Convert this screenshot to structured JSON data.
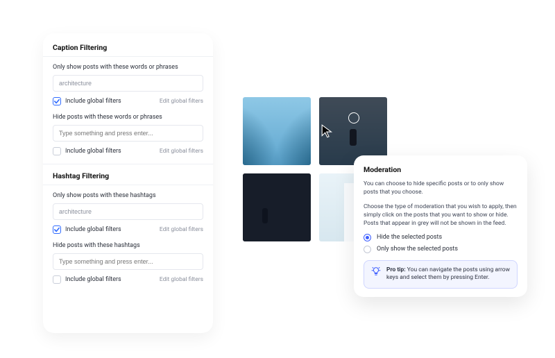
{
  "settings": {
    "caption": {
      "heading": "Caption Filtering",
      "show": {
        "label": "Only show posts with these words or phrases",
        "value": "architecture",
        "include_checked": true,
        "include_label": "Include global filters",
        "edit": "Edit global filters"
      },
      "hide": {
        "label": "Hide posts with these words or phrases",
        "placeholder": "Type something and press enter...",
        "include_checked": false,
        "include_label": "Include global filters",
        "edit": "Edit global filters"
      }
    },
    "hashtag": {
      "heading": "Hashtag Filtering",
      "show": {
        "label": "Only show posts with these hashtags",
        "value": "architecture",
        "include_checked": true,
        "include_label": "Include global filters",
        "edit": "Edit global filters"
      },
      "hide": {
        "label": "Hide posts with these hashtags",
        "placeholder": "Type something and press enter...",
        "include_checked": false,
        "include_label": "Include global filters",
        "edit": "Edit global filters"
      }
    }
  },
  "grid": {
    "items": [
      {
        "name": "post-1",
        "muted": false
      },
      {
        "name": "post-2",
        "muted": true
      },
      {
        "name": "post-3",
        "muted": true
      },
      {
        "name": "post-4",
        "muted": false
      }
    ]
  },
  "moderation": {
    "heading": "Moderation",
    "p1": "You can choose to hide specific posts or to only show posts that you choose.",
    "p2": "Choose the type of moderation that you wish to apply, then simply click on the posts that you want to show or hide. Posts that appear in grey will not be shown in the feed.",
    "options": [
      {
        "label": "Hide the selected posts",
        "selected": true
      },
      {
        "label": "Only show the selected posts",
        "selected": false
      }
    ],
    "tip_prefix": "Pro tip:",
    "tip_body": " You can navigate the posts using arrow keys and select them by pressing Enter."
  }
}
